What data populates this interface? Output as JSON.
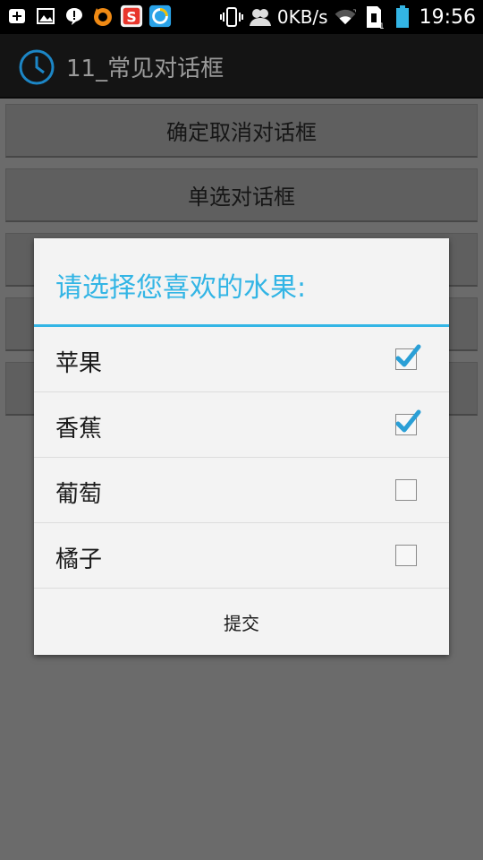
{
  "status_bar": {
    "net_speed": "0KB/s",
    "time": "19:56",
    "icons": [
      "add-icon",
      "image-icon",
      "alert-icon",
      "uc-browser-icon",
      "sogou-icon",
      "browser-icon",
      "vibrate-icon",
      "contacts-icon",
      "wifi-icon",
      "sim-icon",
      "battery-icon"
    ]
  },
  "action_bar": {
    "title": "11_常见对话框",
    "icon": "clock-icon"
  },
  "buttons": [
    {
      "label": "确定取消对话框"
    },
    {
      "label": "单选对话框"
    },
    {
      "label": ""
    },
    {
      "label": ""
    },
    {
      "label": ""
    }
  ],
  "dialog": {
    "title": "请选择您喜欢的水果:",
    "options": [
      {
        "label": "苹果",
        "checked": true
      },
      {
        "label": "香蕉",
        "checked": true
      },
      {
        "label": "葡萄",
        "checked": false
      },
      {
        "label": "橘子",
        "checked": false
      }
    ],
    "submit_label": "提交"
  },
  "colors": {
    "accent": "#33b5e5",
    "dim_background": "#6b6b6b"
  }
}
